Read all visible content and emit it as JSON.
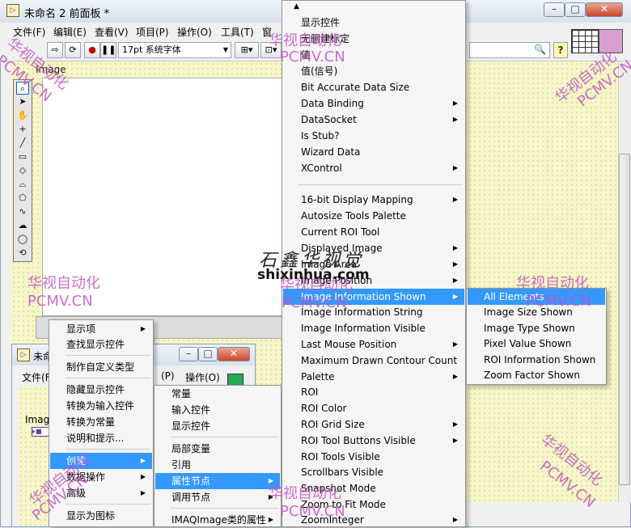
{
  "main_window": {
    "title": "未命名 2 前面板 *",
    "menus": [
      "文件(F)",
      "编辑(E)",
      "查看(V)",
      "项目(P)",
      "操作(O)",
      "工具(T)",
      "窗"
    ],
    "font_select": "17pt 系统字体",
    "image_label": "Image",
    "help_glyph": "?"
  },
  "second_window": {
    "title": "未命",
    "menus": [
      "文件(F)",
      "(P)",
      "操作(O)"
    ],
    "image_label": "Imag"
  },
  "context_menu": {
    "items": [
      {
        "label": "显示项",
        "submenu": true
      },
      {
        "label": "查找显示控件",
        "submenu": false
      },
      {
        "label": "制作自定义类型",
        "submenu": false
      },
      {
        "label": "隐藏显示控件",
        "submenu": false
      },
      {
        "label": "转换为输入控件",
        "submenu": false
      },
      {
        "label": "转换为常量",
        "submenu": false
      },
      {
        "label": "说明和提示...",
        "submenu": false
      },
      {
        "label": "创建",
        "submenu": true,
        "highlighted": true
      },
      {
        "label": "数据操作",
        "submenu": true
      },
      {
        "label": "高级",
        "submenu": true
      },
      {
        "label": "显示为图标",
        "submenu": false
      }
    ]
  },
  "create_submenu": {
    "items": [
      {
        "label": "常量",
        "submenu": false
      },
      {
        "label": "输入控件",
        "submenu": false
      },
      {
        "label": "显示控件",
        "submenu": false
      },
      {
        "label": "局部变量",
        "submenu": false
      },
      {
        "label": "引用",
        "submenu": false
      },
      {
        "label": "属性节点",
        "submenu": true,
        "highlighted": true
      },
      {
        "label": "调用节点",
        "submenu": true
      },
      {
        "label": "IMAQImage类的属性",
        "submenu": true
      }
    ]
  },
  "property_menu": {
    "items": [
      {
        "label": "显示控件",
        "submenu": false
      },
      {
        "label": "无删建标定",
        "submenu": false
      },
      {
        "label": "值",
        "submenu": false
      },
      {
        "label": "值(信号)",
        "submenu": false
      },
      {
        "label": "Bit Accurate Data Size",
        "submenu": false
      },
      {
        "label": "Data Binding",
        "submenu": true
      },
      {
        "label": "DataSocket",
        "submenu": true
      },
      {
        "label": "Is Stub?",
        "submenu": false
      },
      {
        "label": "Wizard Data",
        "submenu": false
      },
      {
        "label": "XControl",
        "submenu": true
      },
      {
        "label": "16-bit Display Mapping",
        "submenu": true
      },
      {
        "label": "Autosize Tools Palette",
        "submenu": false
      },
      {
        "label": "Current ROI Tool",
        "submenu": false
      },
      {
        "label": "Displayed Image",
        "submenu": true
      },
      {
        "label": "Image Area",
        "submenu": true
      },
      {
        "label": "Image Position",
        "submenu": true
      },
      {
        "label": "Image Information Shown",
        "submenu": true,
        "highlighted": true
      },
      {
        "label": "Image Information String",
        "submenu": false
      },
      {
        "label": "Image Information Visible",
        "submenu": false
      },
      {
        "label": "Last Mouse Position",
        "submenu": true
      },
      {
        "label": "Maximum Drawn Contour Count",
        "submenu": false
      },
      {
        "label": "Palette",
        "submenu": true
      },
      {
        "label": "ROI",
        "submenu": false
      },
      {
        "label": "ROI Color",
        "submenu": false
      },
      {
        "label": "ROI Grid Size",
        "submenu": true
      },
      {
        "label": "ROI Tool Buttons Visible",
        "submenu": true
      },
      {
        "label": "ROI Tools Visible",
        "submenu": false
      },
      {
        "label": "Scrollbars Visible",
        "submenu": false
      },
      {
        "label": "Snapshot Mode",
        "submenu": false
      },
      {
        "label": "Zoom to Fit Mode",
        "submenu": false
      },
      {
        "label": "ZoomInteger",
        "submenu": true
      }
    ]
  },
  "image_info_submenu": {
    "items": [
      {
        "label": "All Elements",
        "highlighted": true
      },
      {
        "label": "Image Size Shown"
      },
      {
        "label": "Image Type Shown"
      },
      {
        "label": "Pixel Value Shown"
      },
      {
        "label": "ROI Information Shown"
      },
      {
        "label": "Zoom Factor Shown"
      }
    ]
  },
  "watermarks": {
    "cn": "华视自动化",
    "en": "PCMV.CN",
    "site_logo": "石鑫华视觉",
    "site_url": "shixinhua.com"
  },
  "colors": {
    "highlight": "#3399ff",
    "watermark": "#c050c0",
    "panel": "#f6f6c8"
  }
}
